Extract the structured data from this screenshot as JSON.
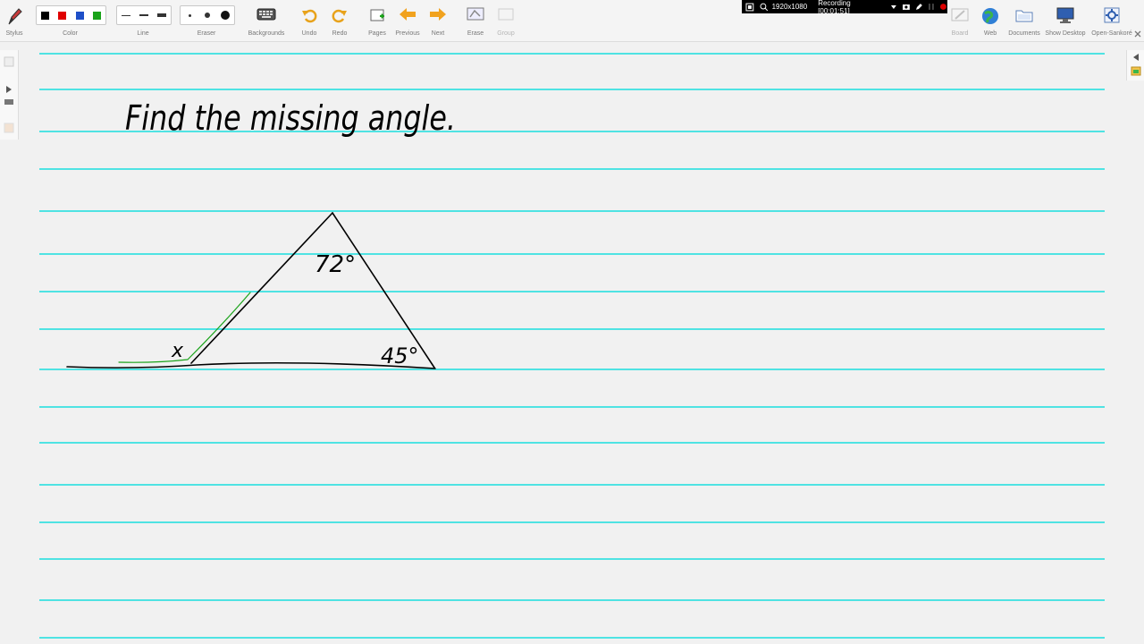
{
  "toolbar": {
    "stylus": "Stylus",
    "color": "Color",
    "line": "Line",
    "eraser": "Eraser",
    "backgrounds": "Backgrounds",
    "undo": "Undo",
    "redo": "Redo",
    "pages": "Pages",
    "previous": "Previous",
    "next": "Next",
    "erase": "Erase",
    "group": "Group",
    "board": "Board",
    "web": "Web",
    "documents": "Documents",
    "show_desktop": "Show Desktop",
    "open_sankore": "Open-Sankoré"
  },
  "colors": {
    "black": "#000000",
    "red": "#e00000",
    "blue": "#1e4fc8",
    "green": "#1aa31a",
    "rule": "#4fe3e3"
  },
  "recording": {
    "resolution": "1920x1080",
    "status": "Recording [00:01:51]"
  },
  "board": {
    "title": "Find the missing angle.",
    "top_angle": "72°",
    "right_angle": "45°",
    "unknown": "x"
  }
}
